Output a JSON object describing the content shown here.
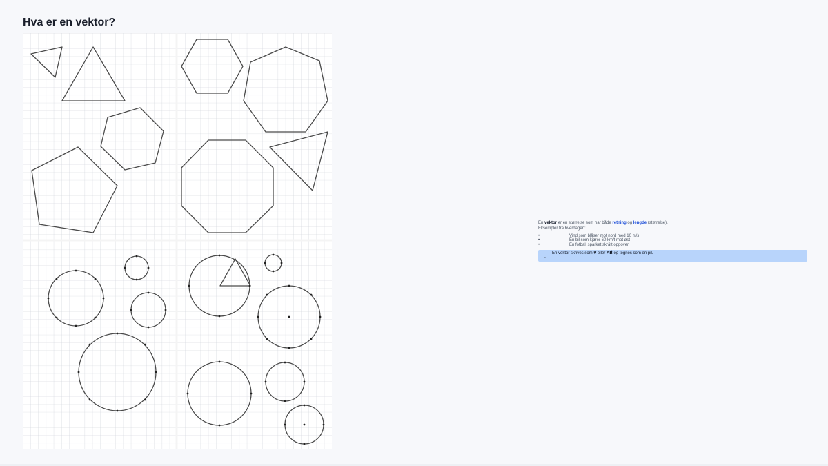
{
  "page": {
    "title": "Hva er en vektor?"
  },
  "body": {
    "intro_pre": "En ",
    "intro_term": "vektor",
    "intro_mid": " er en størrelse som har både ",
    "intro_dir": "retning",
    "intro_and": " og ",
    "intro_len": "lengde",
    "intro_post": " (størrelse).",
    "examples_label": "Eksempler fra hverdagen:",
    "examples": [
      "Vind som blåser mot nord med 10 m/s",
      "En bil som kjører 60 km/t mot øst",
      "En fotball sparket skrått oppover"
    ],
    "note_pre": "En vektor skrives som ",
    "note_v": "v⃗",
    "note_mid": " eller ",
    "note_ab": "AB⃗",
    "note_post": " og tegnes som en pil.",
    "note_mark": "–"
  },
  "colors": {
    "accent": "#1d4ed8",
    "note_bg": "#b8d4fb",
    "grid": "#c9ced6"
  }
}
